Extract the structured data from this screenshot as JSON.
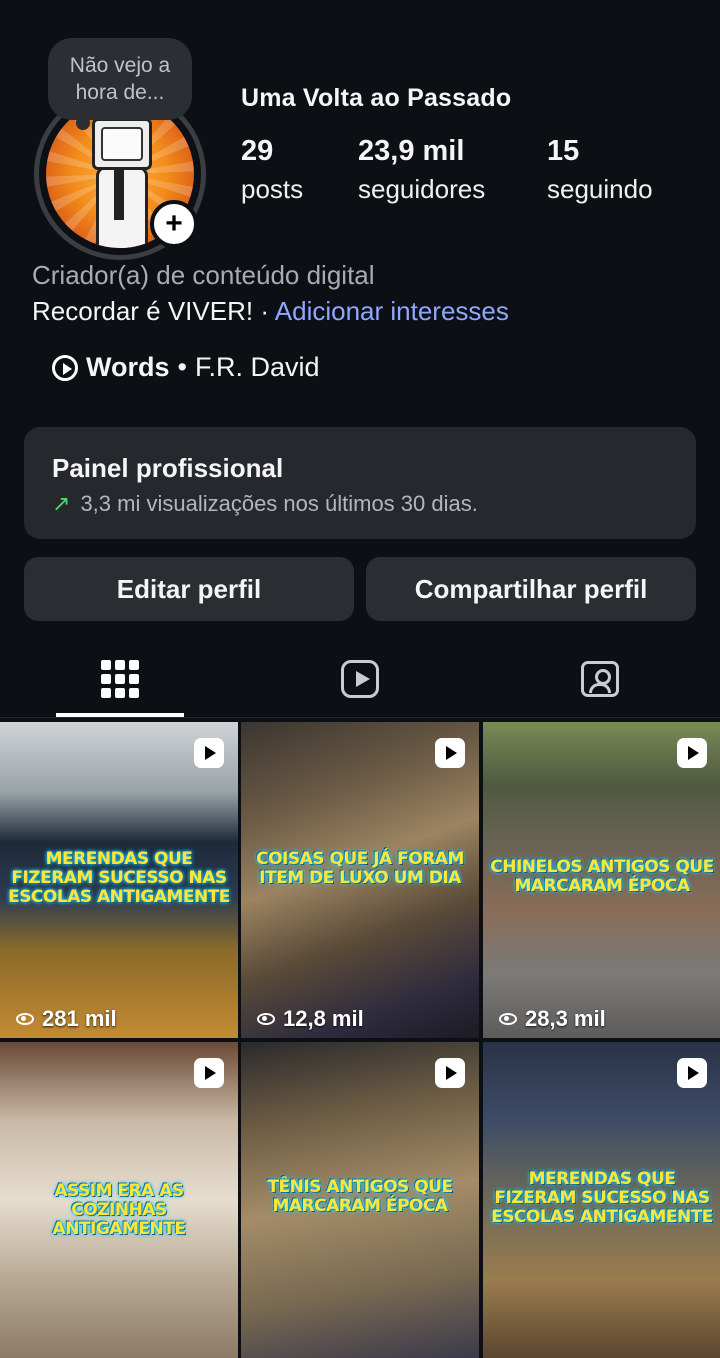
{
  "profile": {
    "name": "Uma Volta ao Passado",
    "note": [
      "Não vejo a",
      "hora de..."
    ],
    "add_badge": "+",
    "stats": [
      {
        "value": "29",
        "label": "posts"
      },
      {
        "value": "23,9 mil",
        "label": "seguidores"
      },
      {
        "value": "15",
        "label": "seguindo"
      }
    ],
    "category": "Criador(a) de conteúdo digital",
    "bio_text": "Recordar é VIVER! · ",
    "bio_link": "Adicionar interesses",
    "music_title": "Words",
    "music_sep": "•",
    "music_artist": "F.R. David"
  },
  "dashboard": {
    "title": "Painel profissional",
    "trend_icon": "trend-up-icon",
    "subtitle": "3,3 mi visualizações nos últimos 30 dias."
  },
  "buttons": {
    "edit": "Editar perfil",
    "share": "Compartilhar perfil"
  },
  "tabs": [
    {
      "icon": "grid-icon",
      "active": true
    },
    {
      "icon": "reels-icon",
      "active": false
    },
    {
      "icon": "tagged-icon",
      "active": false
    }
  ],
  "posts": [
    {
      "caption": "Merendas que fizeram sucesso nas escolas antigamente",
      "views": "281 mil"
    },
    {
      "caption": "Coisas que já foram item de luxo um dia",
      "views": "12,8 mil"
    },
    {
      "caption": "Chinelos antigos que marcaram época",
      "views": "28,3 mil"
    },
    {
      "caption": "Assim era as cozinhas antigamente",
      "views": ""
    },
    {
      "caption": "Tênis antigos que marcaram época",
      "views": ""
    },
    {
      "caption": "Merendas que fizeram sucesso nas escolas antigamente",
      "views": ""
    }
  ],
  "colors": {
    "background": "#0c0f14",
    "card": "#25282d",
    "link": "#8fa7ff",
    "trend": "#4cd964",
    "caption": "#ffe43a"
  }
}
